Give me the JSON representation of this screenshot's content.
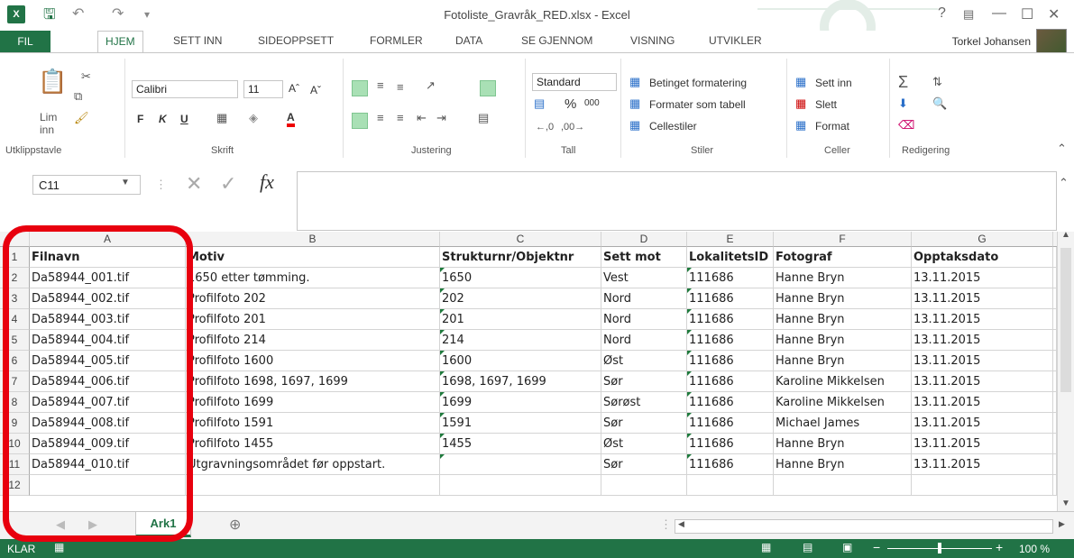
{
  "window": {
    "title": "Fotoliste_Gravråk_RED.xlsx - Excel",
    "app_icon": "X",
    "user": "Torkel Johansen"
  },
  "tabs": [
    "FIL",
    "HJEM",
    "SETT INN",
    "SIDEOPPSETT",
    "FORMLER",
    "DATA",
    "SE GJENNOM",
    "VISNING",
    "UTVIKLER"
  ],
  "ribbon": {
    "clipboard": {
      "paste": "Lim",
      "paste2": "inn",
      "group": "Utklippstavle"
    },
    "font": {
      "name": "Calibri",
      "size": "11",
      "bold": "F",
      "italic": "K",
      "underline": "U",
      "group": "Skrift"
    },
    "alignment": {
      "group": "Justering"
    },
    "number": {
      "format": "Standard",
      "percent": "%",
      "thousands": "000",
      "group": "Tall"
    },
    "styles": {
      "conditional": "Betinget formatering",
      "table": "Formater som tabell",
      "cell": "Cellestiler",
      "group": "Stiler"
    },
    "cells": {
      "insert": "Sett inn",
      "delete": "Slett",
      "format": "Format",
      "group": "Celler"
    },
    "editing": {
      "group": "Redigering"
    }
  },
  "formula_bar": {
    "name_box": "C11",
    "fx": "fx",
    "content": ""
  },
  "grid": {
    "columns": [
      "A",
      "B",
      "C",
      "D",
      "E",
      "F",
      "G"
    ],
    "rows": [
      {
        "n": "1",
        "cells": [
          "Filnavn",
          "Motiv",
          "Strukturnr/Objektnr",
          "Sett mot",
          "LokalitetsID",
          "Fotograf",
          "Opptaksdato"
        ]
      },
      {
        "n": "2",
        "cells": [
          "Da58944_001.tif",
          "1650 etter tømming.",
          "1650",
          "Vest",
          "111686",
          "Hanne Bryn",
          "13.11.2015"
        ]
      },
      {
        "n": "3",
        "cells": [
          "Da58944_002.tif",
          "Profilfoto 202",
          "202",
          "Nord",
          "111686",
          "Hanne Bryn",
          "13.11.2015"
        ]
      },
      {
        "n": "4",
        "cells": [
          "Da58944_003.tif",
          "Profilfoto 201",
          "201",
          "Nord",
          "111686",
          "Hanne Bryn",
          "13.11.2015"
        ]
      },
      {
        "n": "5",
        "cells": [
          "Da58944_004.tif",
          "Profilfoto 214",
          "214",
          "Nord",
          "111686",
          "Hanne Bryn",
          "13.11.2015"
        ]
      },
      {
        "n": "6",
        "cells": [
          "Da58944_005.tif",
          "Profilfoto 1600",
          "1600",
          "Øst",
          "111686",
          "Hanne Bryn",
          "13.11.2015"
        ]
      },
      {
        "n": "7",
        "cells": [
          "Da58944_006.tif",
          "Profilfoto 1698, 1697, 1699",
          "1698, 1697, 1699",
          "Sør",
          "111686",
          "Karoline Mikkelsen",
          "13.11.2015"
        ]
      },
      {
        "n": "8",
        "cells": [
          "Da58944_007.tif",
          "Profilfoto 1699",
          "1699",
          "Sørøst",
          "111686",
          "Karoline Mikkelsen",
          "13.11.2015"
        ]
      },
      {
        "n": "9",
        "cells": [
          "Da58944_008.tif",
          "Profilfoto 1591",
          "1591",
          "Sør",
          "111686",
          "Michael James",
          "13.11.2015"
        ]
      },
      {
        "n": "10",
        "cells": [
          "Da58944_009.tif",
          "Profilfoto 1455",
          "1455",
          "Øst",
          "111686",
          "Hanne Bryn",
          "13.11.2015"
        ]
      },
      {
        "n": "11",
        "cells": [
          "Da58944_010.tif",
          "Utgravningsområdet før oppstart.",
          "",
          "Sør",
          "111686",
          "Hanne Bryn",
          "13.11.2015"
        ]
      },
      {
        "n": "12",
        "cells": [
          "",
          "",
          "",
          "",
          "",
          "",
          ""
        ]
      }
    ]
  },
  "sheets": {
    "active": "Ark1"
  },
  "status": {
    "ready": "KLAR",
    "zoom": "100 %"
  },
  "colors": {
    "accent": "#217346",
    "highlight": "#e8000e"
  }
}
